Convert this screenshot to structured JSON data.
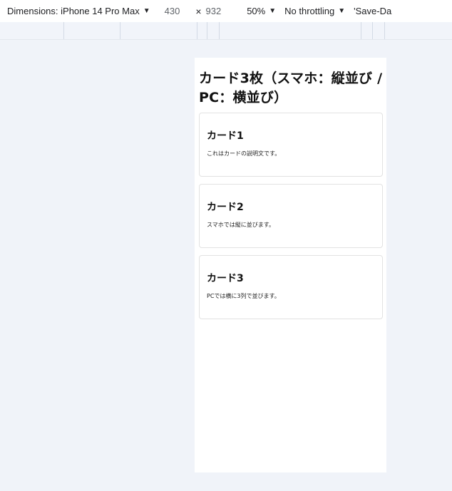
{
  "devtools": {
    "dimensions_label": "Dimensions: iPhone 14 Pro Max",
    "width": "430",
    "times": "×",
    "height": "932",
    "zoom": "50%",
    "throttling": "No throttling",
    "save_data": "'Save-Da",
    "dropdown_glyph": "▼"
  },
  "page": {
    "title": "カード3枚（スマホ：縦並び / PC：横並び）",
    "cards": [
      {
        "title": "カード1",
        "text": "これはカードの説明文です。"
      },
      {
        "title": "カード2",
        "text": "スマホでは縦に並びます。"
      },
      {
        "title": "カード3",
        "text": "PCでは横に3列で並びます。"
      }
    ]
  }
}
